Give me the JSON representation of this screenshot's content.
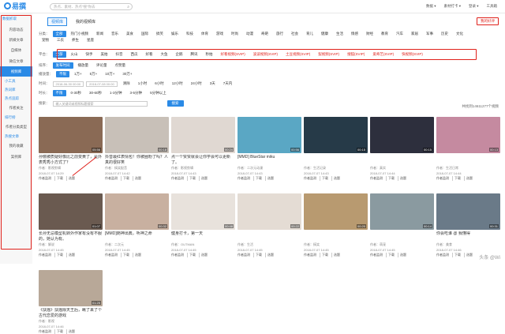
{
  "header": {
    "logo": "易撰",
    "search_placeholder": "热点、素材、热点“搜”你去",
    "links": [
      "数据 ▾",
      "素材打卡 ▾",
      "登录 ▾",
      "工具箱"
    ]
  },
  "sidebar": {
    "title": "数据抓取",
    "items": [
      "内容动态",
      "新媒文章",
      "自媒体",
      "微信文章",
      "视频库"
    ],
    "selected": 4,
    "groups": [
      {
        "label": "小工具",
        "items": []
      },
      {
        "label": "热词库",
        "items": []
      },
      {
        "label": "热点追踪",
        "items": [
          "作者关注"
        ]
      },
      {
        "label": "排行榜",
        "items": [
          "作者分类类型"
        ]
      },
      {
        "label": "热搜文章",
        "items": [
          "我的收藏",
          "案例库"
        ]
      }
    ]
  },
  "tabs": [
    "视频库",
    "我的视频库"
  ],
  "collect_button": "我的好评",
  "category": {
    "label": "分类：",
    "chips": [
      "全部",
      "热门小视频",
      "新闻",
      "音乐",
      "美食",
      "国际",
      "搞笑",
      "娱乐",
      "科技",
      "体育",
      "游戏",
      "时尚",
      "动漫",
      "奇葩",
      "旅行",
      "社会",
      "育儿",
      "健康",
      "生活",
      "情感",
      "财经",
      "教育",
      "汽车",
      "家居",
      "军事",
      "历史",
      "文化",
      "宠物",
      "三农",
      "养生",
      "星座"
    ]
  },
  "platform": {
    "label": "平台：",
    "chips": [
      "全部",
      "火山",
      "快手",
      "美拍",
      "抖音",
      "西瓜",
      "好看",
      "大鱼",
      "企鹅",
      "腾讯",
      "秒拍",
      "好看视频(SVIP)",
      "波波视频(SVIP)",
      "土豆视频(SVIP)",
      "梨视频(SVIP)",
      "搜狐(SVIP)",
      "爱奇艺(SVIP)",
      "快视频(SVIP)"
    ],
    "red_from": 11
  },
  "sort": {
    "label": "排序：",
    "chips": [
      "发布时间",
      "播放量",
      "评论量",
      "点赞量"
    ]
  },
  "playcount": {
    "label": "播放量：",
    "chips": [
      "不限",
      "1万+",
      "5万+",
      "10万+",
      "30万+"
    ]
  },
  "time": {
    "label": "时间：",
    "start": "2018-06-30 00:00",
    "end": "2018-07-08 00:00",
    "chips": [
      "清除",
      "1小时",
      "6小时",
      "12小时",
      "24小时",
      "3天",
      "7天内"
    ]
  },
  "duration": {
    "label": "时长：",
    "chips": [
      "不限",
      "0-30秒",
      "30-60秒",
      "1-3分钟",
      "3-5分钟",
      "5分钟以上"
    ]
  },
  "search": {
    "label": "搜索：",
    "placeholder": "输入关键词或视频标题搜索",
    "button": "搜索"
  },
  "result_count": "共找到14611277个视频",
  "cards": [
    {
      "title": "孙俪被质疑好像比之前变黄了，是外表秀秀小方式了？",
      "author": "作者：影视剪辑",
      "date": "2018-07-07 14:29",
      "dur": "05:56",
      "bg": "#8a6a55",
      "btns": [
        "作者监测",
        "下载",
        "选题"
      ]
    },
    {
      "title": "抖音最红表情包！你被圈粉了吗？人真的很好笑",
      "author": "作者：搞笑配音",
      "date": "2018-07-07 14:42",
      "dur": "00:18",
      "bg": "#c8c0b8",
      "btns": [
        "作者监测",
        "下载",
        "选题"
      ]
    },
    {
      "title": "点一个赞赞就会让你学会可以更新了。",
      "author": "作者：影视剪辑",
      "date": "2018-07-07 14:43",
      "dur": "00:24",
      "bg": "#e0d8d2",
      "btns": [
        "作者监测",
        "下载",
        "选题"
      ]
    },
    {
      "title": "[MMD] BlueStar miku",
      "author": "作者：二次元动漫",
      "date": "2018-07-07 14:43",
      "dur": "00:56",
      "bg": "#5aa7c4",
      "btns": [
        "作者监测",
        "下载",
        "选题"
      ]
    },
    {
      "title": "",
      "author": "作者：生活记录",
      "date": "2018-07-07 14:43",
      "dur": "00:15",
      "bg": "#263a48",
      "btns": [
        "作者监测",
        "下载",
        "选题"
      ]
    },
    {
      "title": "",
      "author": "作者：真实",
      "date": "2018-07-07 14:44",
      "dur": "00:15",
      "bg": "#2d2f3d",
      "btns": [
        "作者监测",
        "下载",
        "选题"
      ]
    },
    {
      "title": "",
      "author": "作者：生活日常",
      "date": "2018-07-07 14:44",
      "dur": "00:13",
      "bg": "#c58aa0",
      "btns": [
        "作者监测",
        "下载",
        "选题"
      ]
    },
    {
      "title": "长孙无忌模型机转外作家有没有不服的，她认为有。",
      "author": "作者：解说",
      "date": "2018-07-07 14:45",
      "dur": "01:07",
      "bg": "#6a5a50",
      "btns": [
        "作者监测",
        "下载",
        "选题"
      ]
    },
    {
      "title": "[MMD]随神出典，听神之命",
      "author": "作者：二次元",
      "date": "2018-07-07 14:45",
      "dur": "00:32",
      "bg": "#c8b0a0",
      "btns": [
        "作者监测",
        "下载",
        "选题"
      ]
    },
    {
      "title": "健身打卡，第一天",
      "author": "作者：OUTMAN",
      "date": "2018-07-07 14:45",
      "dur": "00:48",
      "bg": "#e8e2dc",
      "btns": [
        "作者监测",
        "下载",
        "选题"
      ]
    },
    {
      "title": "",
      "author": "作者：生活",
      "date": "2018-07-07 14:45",
      "dur": "00:22",
      "bg": "#e4dcd4",
      "btns": [
        "作者监测",
        "下载",
        "选题"
      ]
    },
    {
      "title": "",
      "author": "作者：搞笑",
      "date": "2018-07-07 14:45",
      "dur": "00:20",
      "bg": "#b89a70",
      "btns": [
        "作者监测",
        "下载",
        "选题"
      ]
    },
    {
      "title": "",
      "author": "作者：萌宠",
      "date": "2018-07-07 14:45",
      "dur": "00:14",
      "bg": "#8a9aa0",
      "btns": [
        "作者监测",
        "下载",
        "选题"
      ]
    },
    {
      "title": "你会吃谁 @ 我懂得",
      "author": "作者：美食",
      "date": "2018-07-07 14:46",
      "dur": "00:31",
      "bg": "#6a7a88",
      "btns": [
        "作者监测",
        "下载",
        "选题"
      ]
    },
    {
      "title": "《扶摇》扶摇除天王后，瞅了来了个古代恋爱的游戏",
      "author": "作者：影视",
      "date": "2018-07-07 14:46",
      "dur": "01:25",
      "bg": "#b8a898",
      "btns": [
        "作者监测",
        "下载",
        "选题"
      ]
    }
  ],
  "watermark": "头条 @Wi"
}
